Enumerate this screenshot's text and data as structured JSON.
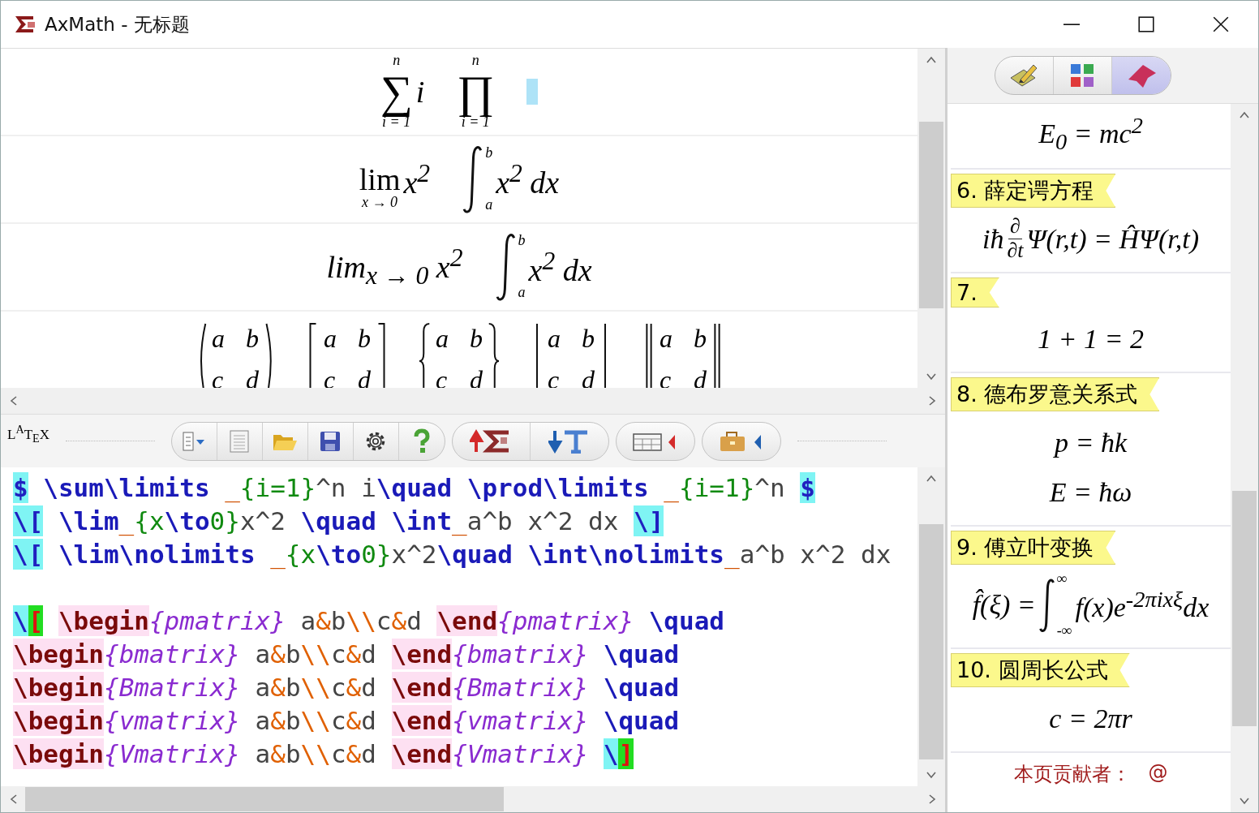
{
  "window": {
    "title": "AxMath - 无标题"
  },
  "preview": {
    "rows": [
      {
        "caret": true,
        "items": [
          {
            "kind": "stack",
            "symbol": "∑",
            "upper": "n",
            "lower": "i = 1",
            "body": "i"
          },
          {
            "kind": "stack",
            "symbol": "∏",
            "upper": "n",
            "lower": "i = 1"
          }
        ]
      },
      {
        "caret": false,
        "items": [
          {
            "kind": "stack",
            "symbol": "lim",
            "lower": "x → 0",
            "body": "x$^{2}$"
          },
          {
            "kind": "integral",
            "upper": "b",
            "lower": "a",
            "body": "x$^{2}$ dx"
          }
        ]
      },
      {
        "caret": false,
        "items": [
          {
            "kind": "inline",
            "text": "lim$_{x → 0}$ x$^{2}$"
          },
          {
            "kind": "integral",
            "upper": "b",
            "lower": "a",
            "body": "x$^{2}$ dx"
          }
        ]
      },
      {
        "caret": false,
        "items": [
          {
            "kind": "paren-matrix",
            "cells": [
              "a",
              "b",
              "c",
              "d"
            ]
          },
          {
            "kind": "bracket-matrix",
            "cells": [
              "a",
              "b",
              "c",
              "d"
            ]
          },
          {
            "kind": "brace-matrix",
            "cells": [
              "a",
              "b",
              "c",
              "d"
            ]
          },
          {
            "kind": "bar-matrix",
            "cells": [
              "a",
              "b",
              "c",
              "d"
            ]
          },
          {
            "kind": "double-bar-matrix",
            "cells": [
              "a",
              "b",
              "c",
              "d"
            ]
          }
        ]
      }
    ]
  },
  "toolbar": {
    "logo": "L$^{A}$T$_{E}$X"
  },
  "editor": {
    "lines": [
      {
        "tokens": [
          {
            "kind": "delim",
            "text": "$"
          },
          {
            "kind": "space"
          },
          {
            "kind": "cmd",
            "text": "\\sum\\limits"
          },
          {
            "kind": "space"
          },
          {
            "kind": "op",
            "text": "_"
          },
          {
            "kind": "brace",
            "text": "{i=1}"
          },
          {
            "kind": "plain",
            "text": "^n i"
          },
          {
            "kind": "cmd",
            "text": "\\quad"
          },
          {
            "kind": "space"
          },
          {
            "kind": "cmd",
            "text": "\\prod\\limits"
          },
          {
            "kind": "space"
          },
          {
            "kind": "op",
            "text": "_"
          },
          {
            "kind": "brace",
            "text": "{i=1}"
          },
          {
            "kind": "plain",
            "text": "^n"
          },
          {
            "kind": "space"
          },
          {
            "kind": "delim",
            "text": "$"
          }
        ]
      },
      {
        "tokens": [
          {
            "kind": "delim",
            "text": "\\["
          },
          {
            "kind": "space"
          },
          {
            "kind": "cmd",
            "text": "\\lim"
          },
          {
            "kind": "op",
            "text": "_"
          },
          {
            "kind": "brace",
            "text": "{x"
          },
          {
            "kind": "cmd",
            "text": "\\to"
          },
          {
            "kind": "brace",
            "text": "0}"
          },
          {
            "kind": "plain",
            "text": "x^2"
          },
          {
            "kind": "space"
          },
          {
            "kind": "cmd",
            "text": "\\quad"
          },
          {
            "kind": "space"
          },
          {
            "kind": "cmd",
            "text": "\\int"
          },
          {
            "kind": "op",
            "text": "_"
          },
          {
            "kind": "plain",
            "text": "a^b x^2 dx"
          },
          {
            "kind": "space"
          },
          {
            "kind": "delim",
            "text": "\\]"
          }
        ]
      },
      {
        "tokens": [
          {
            "kind": "delim",
            "text": "\\["
          },
          {
            "kind": "space"
          },
          {
            "kind": "cmd",
            "text": "\\lim\\nolimits"
          },
          {
            "kind": "space"
          },
          {
            "kind": "op",
            "text": "_"
          },
          {
            "kind": "brace",
            "text": "{x"
          },
          {
            "kind": "cmd",
            "text": "\\to"
          },
          {
            "kind": "brace",
            "text": "0}"
          },
          {
            "kind": "plain",
            "text": "x^2"
          },
          {
            "kind": "cmd",
            "text": "\\quad"
          },
          {
            "kind": "space"
          },
          {
            "kind": "cmd",
            "text": "\\int\\nolimits"
          },
          {
            "kind": "op",
            "text": "_"
          },
          {
            "kind": "plain",
            "text": "a^b x^2 dx"
          }
        ]
      },
      {
        "tokens": [
          {
            "kind": "blank"
          }
        ]
      },
      {
        "tokens": [
          {
            "kind": "delim",
            "text": "\\"
          },
          {
            "kind": "match",
            "text": "["
          },
          {
            "kind": "space"
          },
          {
            "kind": "env",
            "text": "\\begin"
          },
          {
            "kind": "envname",
            "text": "{pmatrix}"
          },
          {
            "kind": "space"
          },
          {
            "kind": "plain",
            "text": "a"
          },
          {
            "kind": "amp",
            "text": "&"
          },
          {
            "kind": "plain",
            "text": "b"
          },
          {
            "kind": "amp",
            "text": "\\\\"
          },
          {
            "kind": "plain",
            "text": "c"
          },
          {
            "kind": "amp",
            "text": "&"
          },
          {
            "kind": "plain",
            "text": "d"
          },
          {
            "kind": "space"
          },
          {
            "kind": "env",
            "text": "\\end"
          },
          {
            "kind": "envname",
            "text": "{pmatrix}"
          },
          {
            "kind": "space"
          },
          {
            "kind": "cmd",
            "text": "\\quad"
          }
        ]
      },
      {
        "tokens": [
          {
            "kind": "env",
            "text": "\\begin"
          },
          {
            "kind": "envname",
            "text": "{bmatrix}"
          },
          {
            "kind": "space"
          },
          {
            "kind": "plain",
            "text": "a"
          },
          {
            "kind": "amp",
            "text": "&"
          },
          {
            "kind": "plain",
            "text": "b"
          },
          {
            "kind": "amp",
            "text": "\\\\"
          },
          {
            "kind": "plain",
            "text": "c"
          },
          {
            "kind": "amp",
            "text": "&"
          },
          {
            "kind": "plain",
            "text": "d"
          },
          {
            "kind": "space"
          },
          {
            "kind": "env",
            "text": "\\end"
          },
          {
            "kind": "envname",
            "text": "{bmatrix}"
          },
          {
            "kind": "space"
          },
          {
            "kind": "cmd",
            "text": "\\quad"
          }
        ]
      },
      {
        "tokens": [
          {
            "kind": "env",
            "text": "\\begin"
          },
          {
            "kind": "envname",
            "text": "{Bmatrix}"
          },
          {
            "kind": "space"
          },
          {
            "kind": "plain",
            "text": "a"
          },
          {
            "kind": "amp",
            "text": "&"
          },
          {
            "kind": "plain",
            "text": "b"
          },
          {
            "kind": "amp",
            "text": "\\\\"
          },
          {
            "kind": "plain",
            "text": "c"
          },
          {
            "kind": "amp",
            "text": "&"
          },
          {
            "kind": "plain",
            "text": "d"
          },
          {
            "kind": "space"
          },
          {
            "kind": "env",
            "text": "\\end"
          },
          {
            "kind": "envname",
            "text": "{Bmatrix}"
          },
          {
            "kind": "space"
          },
          {
            "kind": "cmd",
            "text": "\\quad"
          }
        ]
      },
      {
        "tokens": [
          {
            "kind": "env",
            "text": "\\begin"
          },
          {
            "kind": "envname",
            "text": "{vmatrix}"
          },
          {
            "kind": "space"
          },
          {
            "kind": "plain",
            "text": "a"
          },
          {
            "kind": "amp",
            "text": "&"
          },
          {
            "kind": "plain",
            "text": "b"
          },
          {
            "kind": "amp",
            "text": "\\\\"
          },
          {
            "kind": "plain",
            "text": "c"
          },
          {
            "kind": "amp",
            "text": "&"
          },
          {
            "kind": "plain",
            "text": "d"
          },
          {
            "kind": "space"
          },
          {
            "kind": "env",
            "text": "\\end"
          },
          {
            "kind": "envname",
            "text": "{vmatrix}"
          },
          {
            "kind": "space"
          },
          {
            "kind": "cmd",
            "text": "\\quad"
          }
        ]
      },
      {
        "tokens": [
          {
            "kind": "env",
            "text": "\\begin"
          },
          {
            "kind": "envname",
            "text": "{Vmatrix}"
          },
          {
            "kind": "space"
          },
          {
            "kind": "plain",
            "text": "a"
          },
          {
            "kind": "amp",
            "text": "&"
          },
          {
            "kind": "plain",
            "text": "b"
          },
          {
            "kind": "amp",
            "text": "\\\\"
          },
          {
            "kind": "plain",
            "text": "c"
          },
          {
            "kind": "amp",
            "text": "&"
          },
          {
            "kind": "plain",
            "text": "d"
          },
          {
            "kind": "space"
          },
          {
            "kind": "env",
            "text": "\\end"
          },
          {
            "kind": "envname",
            "text": "{Vmatrix}"
          },
          {
            "kind": "space"
          },
          {
            "kind": "delim",
            "text": "\\"
          },
          {
            "kind": "match",
            "text": "]"
          }
        ]
      }
    ]
  },
  "side_panel": {
    "tabs": [
      {
        "selected": false
      },
      {
        "selected": false
      },
      {
        "selected": true
      }
    ],
    "entries": [
      {
        "formulas": [
          [
            {
              "kind": "inline",
              "text": "E$_{0}$ = mc$^{2}$"
            }
          ]
        ]
      },
      {
        "title": "6. 薛定谔方程",
        "formulas": [
          [
            {
              "kind": "inline",
              "text": "iħ"
            },
            {
              "kind": "frac",
              "num": "∂",
              "den": "∂t"
            },
            {
              "kind": "inline",
              "text": "Ψ(r,t) = ĤΨ(r,t)"
            }
          ]
        ]
      },
      {
        "title": "7.",
        "formulas": [
          [
            {
              "kind": "inline",
              "text": "1 + 1 = 2"
            }
          ]
        ]
      },
      {
        "title": "8. 德布罗意关系式",
        "formulas": [
          [
            {
              "kind": "inline",
              "text": "p = ħk"
            }
          ],
          [
            {
              "kind": "inline",
              "text": "E = ħω"
            }
          ]
        ]
      },
      {
        "title": "9. 傅立叶变换",
        "formulas": [
          [
            {
              "kind": "inline",
              "text": "f̂(ξ) ="
            },
            {
              "kind": "integral",
              "upper": "∞",
              "lower": "-∞",
              "body": "f(x)e$^{-2πixξ}$dx"
            }
          ]
        ]
      },
      {
        "title": "10. 圆周长公式",
        "formulas": [
          [
            {
              "kind": "inline",
              "text": "c = 2πr"
            }
          ]
        ]
      }
    ],
    "footer": {
      "label": "本页贡献者：",
      "value": "@"
    }
  }
}
